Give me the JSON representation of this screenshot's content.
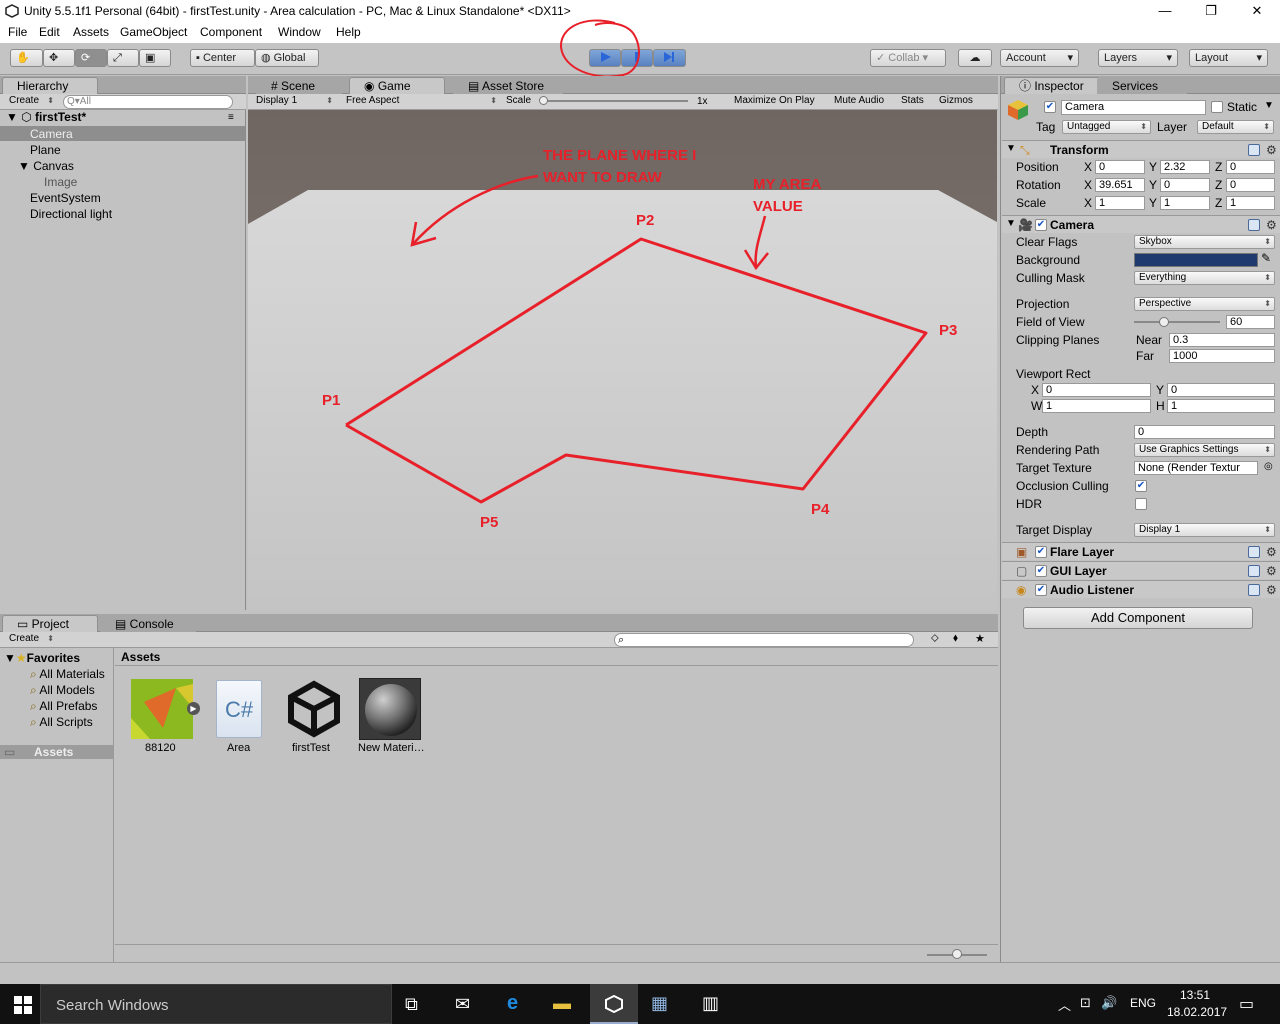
{
  "window": {
    "title": "Unity 5.5.1f1 Personal (64bit) - firstTest.unity - Area calculation - PC, Mac & Linux Standalone* <DX11>",
    "controls": [
      "—",
      "❐",
      "✕"
    ]
  },
  "menu": [
    "File",
    "Edit",
    "Assets",
    "GameObject",
    "Component",
    "Window",
    "Help"
  ],
  "toolbar": {
    "pivot": "Center",
    "space": "Global",
    "collab": "Collab",
    "account": "Account",
    "layers": "Layers",
    "layout": "Layout"
  },
  "hierarchy": {
    "tab": "Hierarchy",
    "create": "Create",
    "search_placeholder": "Q▾All",
    "scene": "firstTest*",
    "items": [
      "Camera",
      "Plane",
      "Canvas",
      "Image",
      "EventSystem",
      "Directional light"
    ]
  },
  "viewtabs": {
    "scene": "Scene",
    "game": "Game",
    "store": "Asset Store"
  },
  "gamebar": {
    "display": "Display 1",
    "aspect": "Free Aspect",
    "scale_label": "Scale",
    "scale_value": "1x",
    "maximize": "Maximize On Play",
    "mute": "Mute Audio",
    "stats": "Stats",
    "gizmos": "Gizmos"
  },
  "annotations": {
    "plane_note": "THE PLANE WHERE I\nWANT TO DRAW",
    "area_note": "MY AREA\nVALUE",
    "points": [
      "P1",
      "P2",
      "P3",
      "P4",
      "P5"
    ],
    "color": "#e8202a"
  },
  "inspector": {
    "tab": "Inspector",
    "services": "Services",
    "object_name": "Camera",
    "static_label": "Static",
    "tag_label": "Tag",
    "tag_value": "Untagged",
    "layer_label": "Layer",
    "layer_value": "Default",
    "transform": {
      "title": "Transform",
      "position_label": "Position",
      "pos": [
        "0",
        "2.32",
        "0"
      ],
      "rotation_label": "Rotation",
      "rot": [
        "39.651",
        "0",
        "0"
      ],
      "scale_label": "Scale",
      "scale": [
        "1",
        "1",
        "1"
      ]
    },
    "camera": {
      "title": "Camera",
      "clear_flags_label": "Clear Flags",
      "clear_flags": "Skybox",
      "background_label": "Background",
      "background_color": "#1e3a6e",
      "culling_label": "Culling Mask",
      "culling": "Everything",
      "projection_label": "Projection",
      "projection": "Perspective",
      "fov_label": "Field of View",
      "fov": "60",
      "clipping_label": "Clipping Planes",
      "near_label": "Near",
      "near": "0.3",
      "far_label": "Far",
      "far": "1000",
      "viewport_label": "Viewport Rect",
      "vx": "0",
      "vy": "0",
      "vw": "1",
      "vh": "1",
      "depth_label": "Depth",
      "depth": "0",
      "rendering_label": "Rendering Path",
      "rendering": "Use Graphics Settings",
      "target_texture_label": "Target Texture",
      "target_texture": "None (Render Textur",
      "occlusion_label": "Occlusion Culling",
      "hdr_label": "HDR",
      "target_display_label": "Target Display",
      "target_display": "Display 1"
    },
    "components": [
      "Flare Layer",
      "GUI Layer",
      "Audio Listener"
    ],
    "add_component": "Add Component"
  },
  "project": {
    "tab": "Project",
    "console": "Console",
    "create": "Create",
    "favorites": "Favorites",
    "favorites_items": [
      "All Materials",
      "All Models",
      "All Prefabs",
      "All Scripts"
    ],
    "assets_root": "Assets",
    "breadcrumb": "Assets",
    "assets": [
      {
        "name": "88120",
        "icon": "texture-icon"
      },
      {
        "name": "Area",
        "icon": "csharp-script-icon"
      },
      {
        "name": "firstTest",
        "icon": "unity-scene-icon"
      },
      {
        "name": "New Materi…",
        "icon": "material-sphere-icon"
      }
    ]
  },
  "taskbar": {
    "search": "Search Windows",
    "language": "ENG",
    "time": "13:51",
    "date": "18.02.2017"
  }
}
